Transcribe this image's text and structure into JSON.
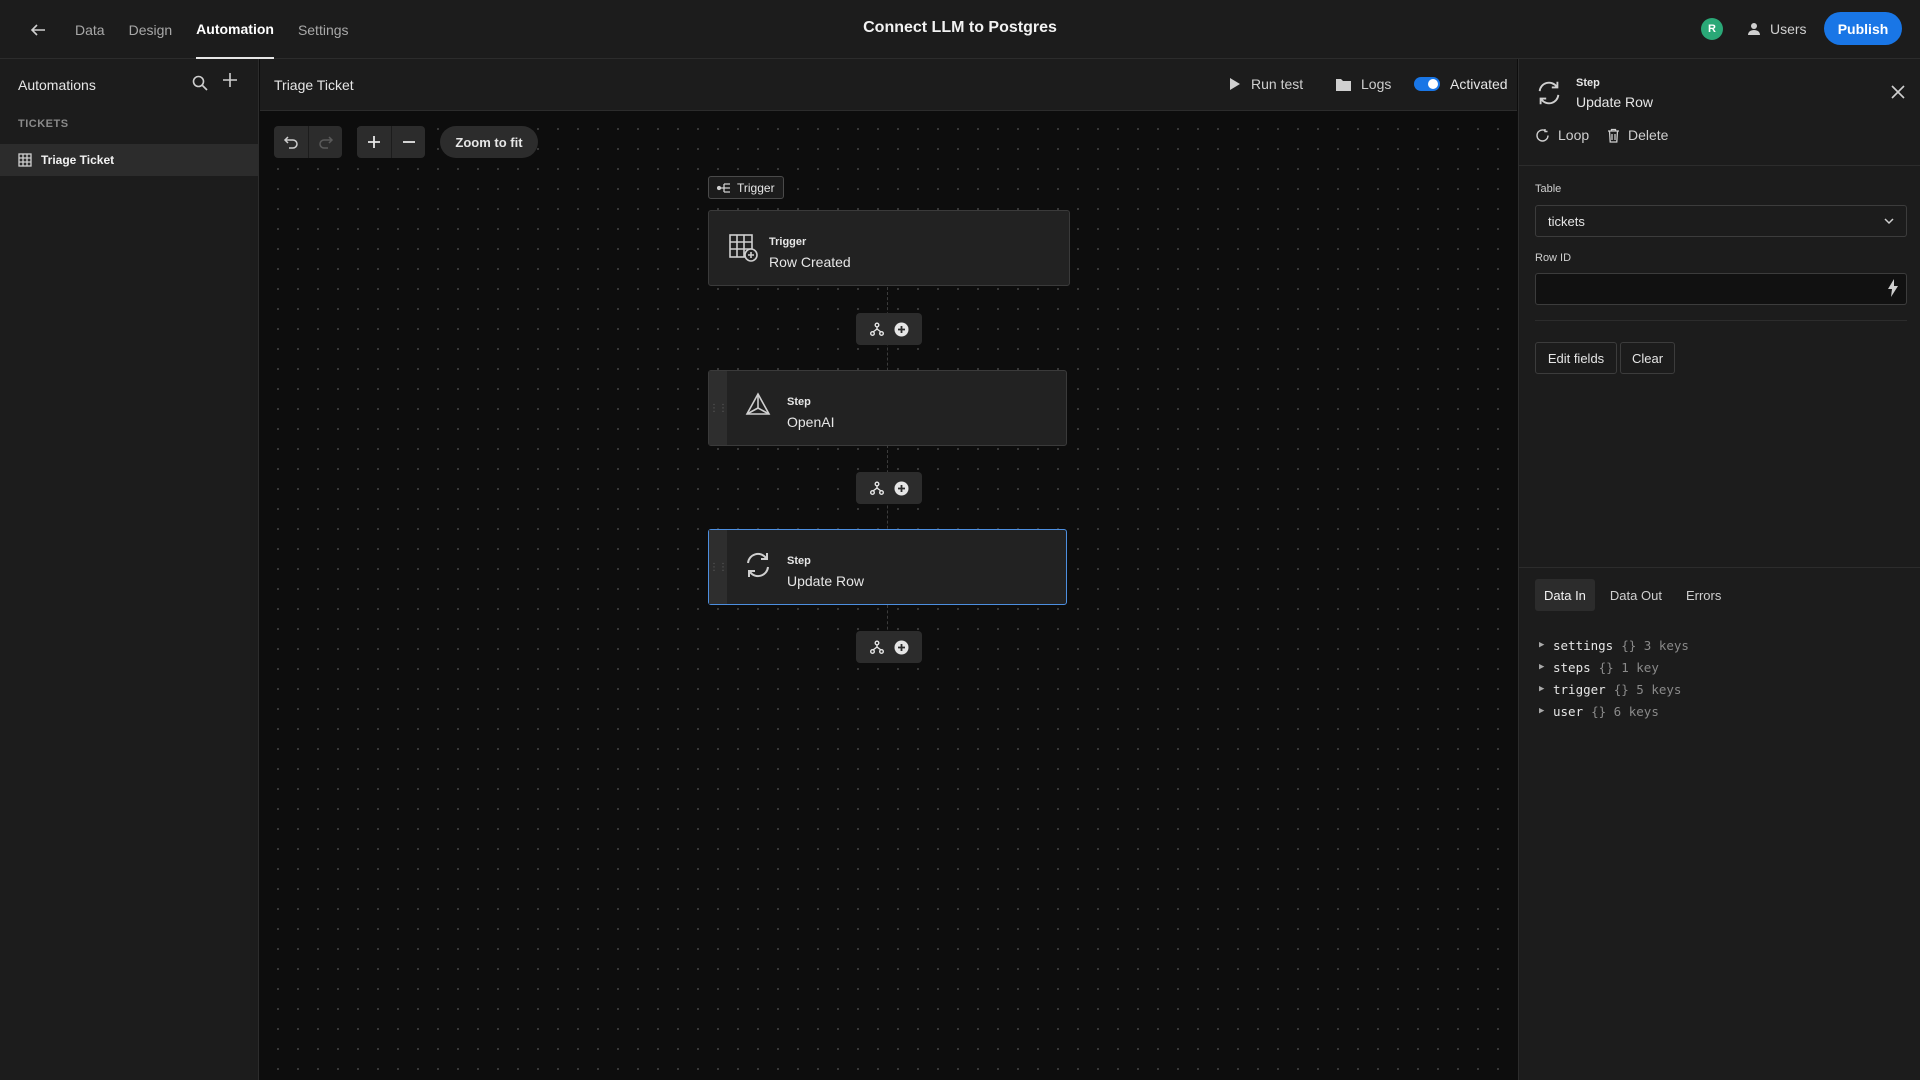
{
  "topbar": {
    "title": "Connect LLM to Postgres",
    "tabs": [
      {
        "label": "Data"
      },
      {
        "label": "Design"
      },
      {
        "label": "Automation"
      },
      {
        "label": "Settings"
      }
    ],
    "active_tab": "Automation",
    "avatar_initial": "R",
    "users_label": "Users",
    "publish_label": "Publish",
    "colors": {
      "accent": "#1976e6",
      "avatar": "#2aa877"
    }
  },
  "sidebar": {
    "title": "Automations",
    "section": "TICKETS",
    "items": [
      {
        "label": "Triage Ticket",
        "icon": "table-icon",
        "selected": true
      }
    ]
  },
  "canvas": {
    "title": "Triage Ticket",
    "run_test_label": "Run test",
    "logs_label": "Logs",
    "activated_label": "Activated",
    "activated": true,
    "zoom_fit_label": "Zoom to fit",
    "trigger_tag": "Trigger",
    "nodes": [
      {
        "type": "Trigger",
        "name": "Row Created",
        "icon": "table-add-icon"
      },
      {
        "type": "Step",
        "name": "OpenAI",
        "icon": "openai-icon"
      },
      {
        "type": "Step",
        "name": "Update Row",
        "icon": "refresh-icon",
        "selected": true
      }
    ]
  },
  "panel": {
    "type": "Step",
    "name": "Update Row",
    "loop_label": "Loop",
    "delete_label": "Delete",
    "table_label": "Table",
    "table_value": "tickets",
    "row_id_label": "Row ID",
    "row_id_value": "",
    "edit_fields_label": "Edit fields",
    "clear_label": "Clear",
    "data_tabs": [
      {
        "label": "Data In",
        "active": true
      },
      {
        "label": "Data Out"
      },
      {
        "label": "Errors"
      }
    ],
    "tree": [
      {
        "key": "settings",
        "meta": "{} 3 keys"
      },
      {
        "key": "steps",
        "meta": "{} 1 key"
      },
      {
        "key": "trigger",
        "meta": "{} 5 keys"
      },
      {
        "key": "user",
        "meta": "{} 6 keys"
      }
    ]
  }
}
